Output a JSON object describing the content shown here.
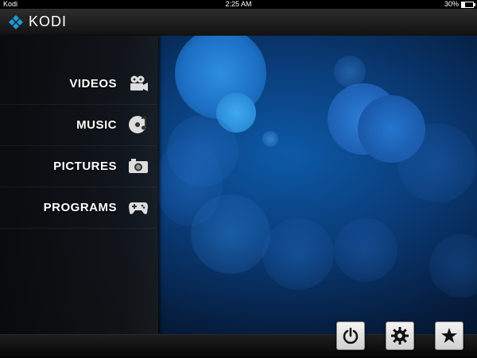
{
  "statusbar": {
    "app": "Kodi",
    "time": "2:25 AM",
    "battery": "30%",
    "battery_level": 0.3
  },
  "header": {
    "logo_text": "KODI",
    "logo_icon": "kodi-logo-icon"
  },
  "menu": {
    "items": [
      {
        "label": "VIDEOS",
        "icon": "video-camera-icon"
      },
      {
        "label": "MUSIC",
        "icon": "music-disc-icon"
      },
      {
        "label": "PICTURES",
        "icon": "photo-camera-icon"
      },
      {
        "label": "PROGRAMS",
        "icon": "gamepad-icon"
      }
    ]
  },
  "bottom_buttons": [
    {
      "name": "power",
      "icon": "power-icon"
    },
    {
      "name": "settings",
      "icon": "gear-icon"
    },
    {
      "name": "favourites",
      "icon": "star-icon"
    }
  ],
  "colors": {
    "background_blue": "#0a3d7a",
    "logo_blue": "#1e9ad6"
  }
}
